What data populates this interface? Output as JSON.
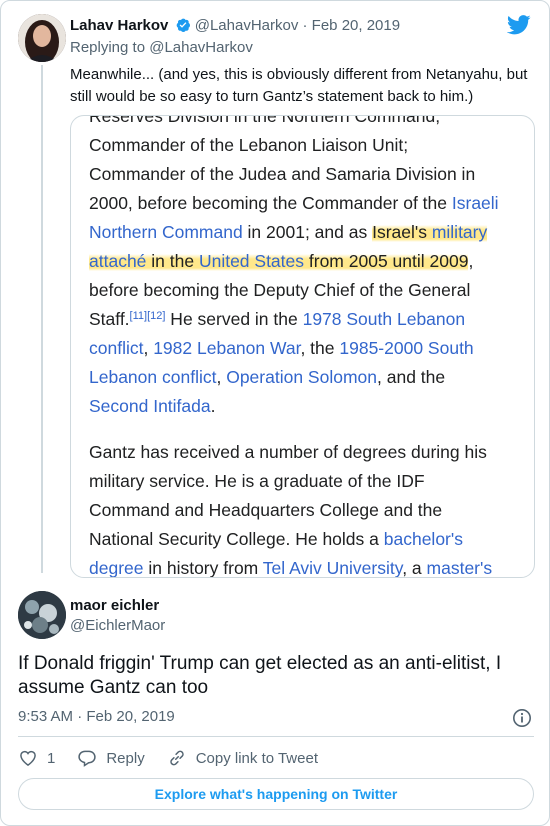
{
  "parent_tweet": {
    "author_name": "Lahav Harkov",
    "handle_and_date": "@LahavHarkov · Feb 20, 2019",
    "replying_to": "Replying to @LahavHarkov",
    "text": "Meanwhile... (and yes, this is obviously different from Netanyahu, but still would be so easy to turn Gantz’s statement back to him.)"
  },
  "embedded_image": {
    "para1": {
      "t1": "Reserves Division in the Northern Command; Commander of the Lebanon Liaison Unit; Commander of the Judea and Samaria Division in 2000, before becoming the Commander of the ",
      "l1": "Israeli Northern Command",
      "t2": " in 2001; and as ",
      "h1": "Israel's ",
      "hl1": "military attaché",
      "h2": " in the ",
      "hl2": "United States",
      "h3": " from 2005 until 2009",
      "t3": ", before becoming the Deputy Chief of the General Staff.",
      "ref": "[11][12]",
      "t4": " He served in the ",
      "l2": "1978 South Lebanon conflict",
      "t5": ", ",
      "l3": "1982 Lebanon War",
      "t6": ", the ",
      "l4": "1985-2000 South Lebanon conflict",
      "t7": ", ",
      "l5": "Operation Solomon",
      "t8": ", and the ",
      "l6": "Second Intifada",
      "t9": "."
    },
    "para2": {
      "t1": "Gantz has received a number of degrees during his military service. He is a graduate of the IDF Command and Headquarters College and the National Security College. He holds a ",
      "l1": "bachelor's degree",
      "t2": " in history from ",
      "l2": "Tel Aviv University",
      "t3": ", a ",
      "l3": "master's"
    }
  },
  "main_tweet": {
    "author_name": "maor eichler",
    "handle": "@EichlerMaor",
    "text": "If Donald friggin' Trump can get elected as an anti-elitist, I assume Gantz can too",
    "timestamp": "9:53 AM · Feb 20, 2019"
  },
  "actions": {
    "like_count": "1",
    "reply_label": "Reply",
    "copy_link_label": "Copy link to Tweet"
  },
  "explore_label": "Explore what's happening on Twitter",
  "colors": {
    "brand": "#1d9bf0",
    "link": "#3366cc",
    "highlight": "#ffe164"
  },
  "icons": [
    "verified-badge-icon",
    "twitter-bird-icon",
    "info-icon",
    "heart-icon",
    "reply-icon",
    "link-icon"
  ]
}
